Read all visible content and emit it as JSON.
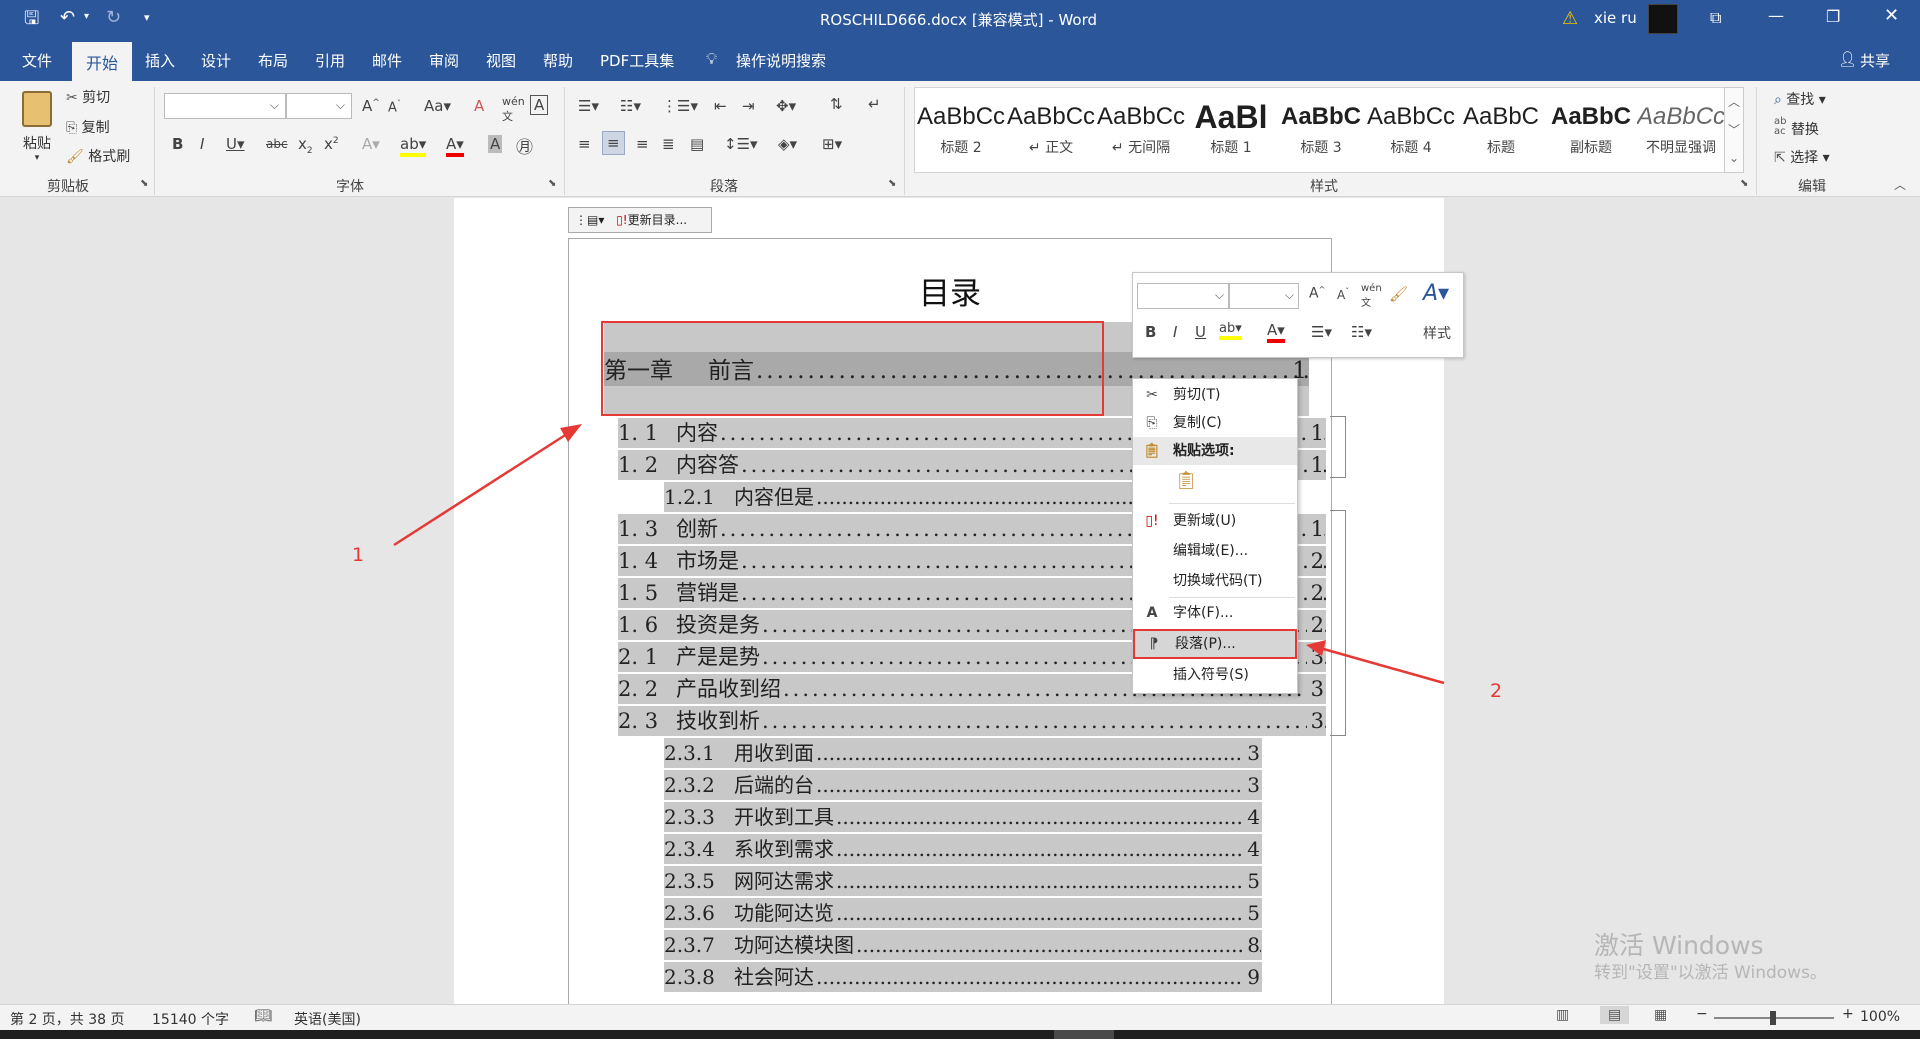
{
  "title_bar": {
    "document_title": "ROSCHILD666.docx [兼容模式]  -  Word",
    "user_name": "xie ru",
    "warning_icon": "warning-icon"
  },
  "tabs": [
    "文件",
    "开始",
    "插入",
    "设计",
    "布局",
    "引用",
    "邮件",
    "审阅",
    "视图",
    "帮助",
    "PDF工具集"
  ],
  "tell_me": "操作说明搜索",
  "share": "共享",
  "clipboard": {
    "paste": "粘贴",
    "cut": "剪切",
    "copy": "复制",
    "format_painter": "格式刷",
    "group": "剪贴板"
  },
  "font_group": {
    "group": "字体"
  },
  "paragraph_group": {
    "group": "段落"
  },
  "styles": {
    "group": "样式",
    "items": [
      {
        "preview": "AaBbCc",
        "name": "标题 2"
      },
      {
        "preview": "AaBbCc",
        "name": "↵ 正文"
      },
      {
        "preview": "AaBbCc",
        "name": "↵ 无间隔"
      },
      {
        "preview": "AaBl",
        "name": "标题 1"
      },
      {
        "preview": "AaBbC",
        "name": "标题 3"
      },
      {
        "preview": "AaBbCc",
        "name": "标题 4"
      },
      {
        "preview": "AaBbC",
        "name": "标题"
      },
      {
        "preview": "AaBbC",
        "name": "副标题"
      },
      {
        "preview": "AaBbCc",
        "name": "不明显强调"
      }
    ]
  },
  "editing": {
    "find": "查找",
    "replace": "替换",
    "select": "选择",
    "group": "编辑"
  },
  "toc_toolbar": {
    "update_toc": "更新目录..."
  },
  "document": {
    "toc_heading": "目录",
    "entries": [
      {
        "num": "第一章",
        "text": "前言",
        "page": "1",
        "level": 0
      },
      {
        "num": "1. 1",
        "text": "内容",
        "page": "1",
        "level": 1
      },
      {
        "num": "1. 2",
        "text": "内容答",
        "page": "1",
        "level": 1
      },
      {
        "num": "1.2.1",
        "text": "内容但是",
        "page": "",
        "level": 2
      },
      {
        "num": "1. 3",
        "text": "创新",
        "page": "1",
        "level": 1
      },
      {
        "num": "1. 4",
        "text": "市场是",
        "page": "2",
        "level": 1
      },
      {
        "num": "1. 5",
        "text": "营销是",
        "page": "2",
        "level": 1
      },
      {
        "num": "1. 6",
        "text": "投资是务",
        "page": "2",
        "level": 1
      },
      {
        "num": "2. 1",
        "text": "产是是势",
        "page": "3",
        "level": 1
      },
      {
        "num": "2. 2",
        "text": "产品收到绍",
        "page": "3",
        "level": 1
      },
      {
        "num": "2. 3",
        "text": "技收到析",
        "page": "3",
        "level": 1
      },
      {
        "num": "2.3.1",
        "text": "用收到面",
        "page": "3",
        "level": 2
      },
      {
        "num": "2.3.2",
        "text": "后端的台",
        "page": "3",
        "level": 2
      },
      {
        "num": "2.3.3",
        "text": "开收到工具",
        "page": "4",
        "level": 2
      },
      {
        "num": "2.3.4",
        "text": "系收到需求",
        "page": "4",
        "level": 2
      },
      {
        "num": "2.3.5",
        "text": "网阿达需求",
        "page": "5",
        "level": 2
      },
      {
        "num": "2.3.6",
        "text": "功能阿达览",
        "page": "5",
        "level": 2
      },
      {
        "num": "2.3.7",
        "text": "功阿达模块图",
        "page": "8",
        "level": 2
      },
      {
        "num": "2.3.8",
        "text": "社会阿达",
        "page": "9",
        "level": 2
      }
    ]
  },
  "mini_toolbar": {
    "styles_label": "样式"
  },
  "context_menu": {
    "items": [
      {
        "label": "剪切(T)",
        "icon": "scissors-icon"
      },
      {
        "label": "复制(C)",
        "icon": "copy-icon"
      },
      {
        "label": "粘贴选项:",
        "icon": "paste-icon"
      },
      {
        "label": "更新域(U)",
        "icon": "update-field-icon"
      },
      {
        "label": "编辑域(E)...",
        "icon": ""
      },
      {
        "label": "切换域代码(T)",
        "icon": ""
      },
      {
        "label": "字体(F)...",
        "icon": "font-icon"
      },
      {
        "label": "段落(P)...",
        "icon": "paragraph-icon"
      },
      {
        "label": "插入符号(S)",
        "icon": ""
      }
    ]
  },
  "annotations": {
    "label_1": "1",
    "label_2": "2"
  },
  "watermark": {
    "line1": "激活 Windows",
    "line2": "转到\"设置\"以激活 Windows。"
  },
  "status_bar": {
    "page": "第 2 页，共 38 页",
    "words": "15140 个字",
    "language": "英语(美国)",
    "zoom": "100%"
  },
  "colors": {
    "accent": "#2b579a",
    "annotation_red": "#e53935",
    "selection_gray": "#c8c8c8"
  }
}
